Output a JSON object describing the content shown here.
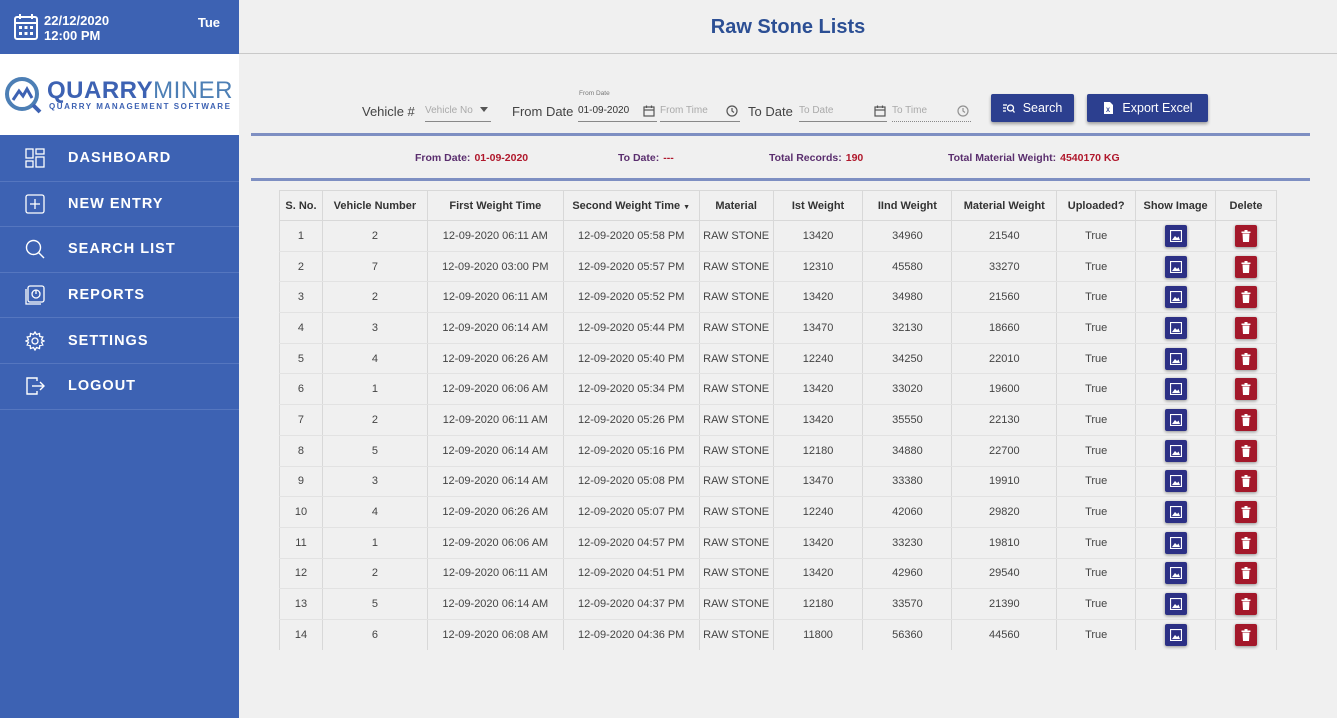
{
  "header": {
    "date": "22/12/2020",
    "time": "12:00 PM",
    "day": "Tue"
  },
  "logo": {
    "part1": "QUARRY",
    "part2": "MINER",
    "tagline": "QUARRY MANAGEMENT SOFTWARE"
  },
  "nav": [
    {
      "label": "DASHBOARD",
      "icon": "dashboard-icon"
    },
    {
      "label": "NEW ENTRY",
      "icon": "plus-square-icon"
    },
    {
      "label": "SEARCH LIST",
      "icon": "search-icon"
    },
    {
      "label": "REPORTS",
      "icon": "reports-icon"
    },
    {
      "label": "SETTINGS",
      "icon": "gear-icon"
    },
    {
      "label": "LOGOUT",
      "icon": "logout-icon"
    }
  ],
  "page": {
    "title": "Raw Stone Lists"
  },
  "filters": {
    "vehicle_label": "Vehicle #",
    "vehicle_placeholder": "Vehicle No",
    "from_date_label": "From Date",
    "from_date_small": "From Date",
    "from_date_value": "01-09-2020",
    "from_time_placeholder": "From Time",
    "to_date_label": "To Date",
    "to_date_placeholder": "To Date",
    "to_time_placeholder": "To Time",
    "search_label": "Search",
    "export_label": "Export Excel"
  },
  "summary": {
    "from_label": "From Date:",
    "from_value": "01-09-2020",
    "to_label": "To Date:",
    "to_value": "---",
    "records_label": "Total Records:",
    "records_value": "190",
    "weight_label": "Total Material Weight:",
    "weight_value": "4540170 KG"
  },
  "table": {
    "headers": [
      "S. No.",
      "Vehicle Number",
      "First Weight Time",
      "Second Weight Time",
      "Material",
      "Ist Weight",
      "IInd Weight",
      "Material Weight",
      "Uploaded?",
      "Show Image",
      "Delete"
    ],
    "rows": [
      [
        "1",
        "2",
        "12-09-2020 06:11 AM",
        "12-09-2020 05:58 PM",
        "RAW STONE",
        "13420",
        "34960",
        "21540",
        "True"
      ],
      [
        "2",
        "7",
        "12-09-2020 03:00 PM",
        "12-09-2020 05:57 PM",
        "RAW STONE",
        "12310",
        "45580",
        "33270",
        "True"
      ],
      [
        "3",
        "2",
        "12-09-2020 06:11 AM",
        "12-09-2020 05:52 PM",
        "RAW STONE",
        "13420",
        "34980",
        "21560",
        "True"
      ],
      [
        "4",
        "3",
        "12-09-2020 06:14 AM",
        "12-09-2020 05:44 PM",
        "RAW STONE",
        "13470",
        "32130",
        "18660",
        "True"
      ],
      [
        "5",
        "4",
        "12-09-2020 06:26 AM",
        "12-09-2020 05:40 PM",
        "RAW STONE",
        "12240",
        "34250",
        "22010",
        "True"
      ],
      [
        "6",
        "1",
        "12-09-2020 06:06 AM",
        "12-09-2020 05:34 PM",
        "RAW STONE",
        "13420",
        "33020",
        "19600",
        "True"
      ],
      [
        "7",
        "2",
        "12-09-2020 06:11 AM",
        "12-09-2020 05:26 PM",
        "RAW STONE",
        "13420",
        "35550",
        "22130",
        "True"
      ],
      [
        "8",
        "5",
        "12-09-2020 06:14 AM",
        "12-09-2020 05:16 PM",
        "RAW STONE",
        "12180",
        "34880",
        "22700",
        "True"
      ],
      [
        "9",
        "3",
        "12-09-2020 06:14 AM",
        "12-09-2020 05:08 PM",
        "RAW STONE",
        "13470",
        "33380",
        "19910",
        "True"
      ],
      [
        "10",
        "4",
        "12-09-2020 06:26 AM",
        "12-09-2020 05:07 PM",
        "RAW STONE",
        "12240",
        "42060",
        "29820",
        "True"
      ],
      [
        "11",
        "1",
        "12-09-2020 06:06 AM",
        "12-09-2020 04:57 PM",
        "RAW STONE",
        "13420",
        "33230",
        "19810",
        "True"
      ],
      [
        "12",
        "2",
        "12-09-2020 06:11 AM",
        "12-09-2020 04:51 PM",
        "RAW STONE",
        "13420",
        "42960",
        "29540",
        "True"
      ],
      [
        "13",
        "5",
        "12-09-2020 06:14 AM",
        "12-09-2020 04:37 PM",
        "RAW STONE",
        "12180",
        "33570",
        "21390",
        "True"
      ],
      [
        "14",
        "6",
        "12-09-2020 06:08 AM",
        "12-09-2020 04:36 PM",
        "RAW STONE",
        "11800",
        "56360",
        "44560",
        "True"
      ]
    ]
  },
  "colors": {
    "sidebar": "#3d62b3",
    "accent": "#2c4f94",
    "button": "#2c3f8f",
    "delete": "#a3182a"
  }
}
